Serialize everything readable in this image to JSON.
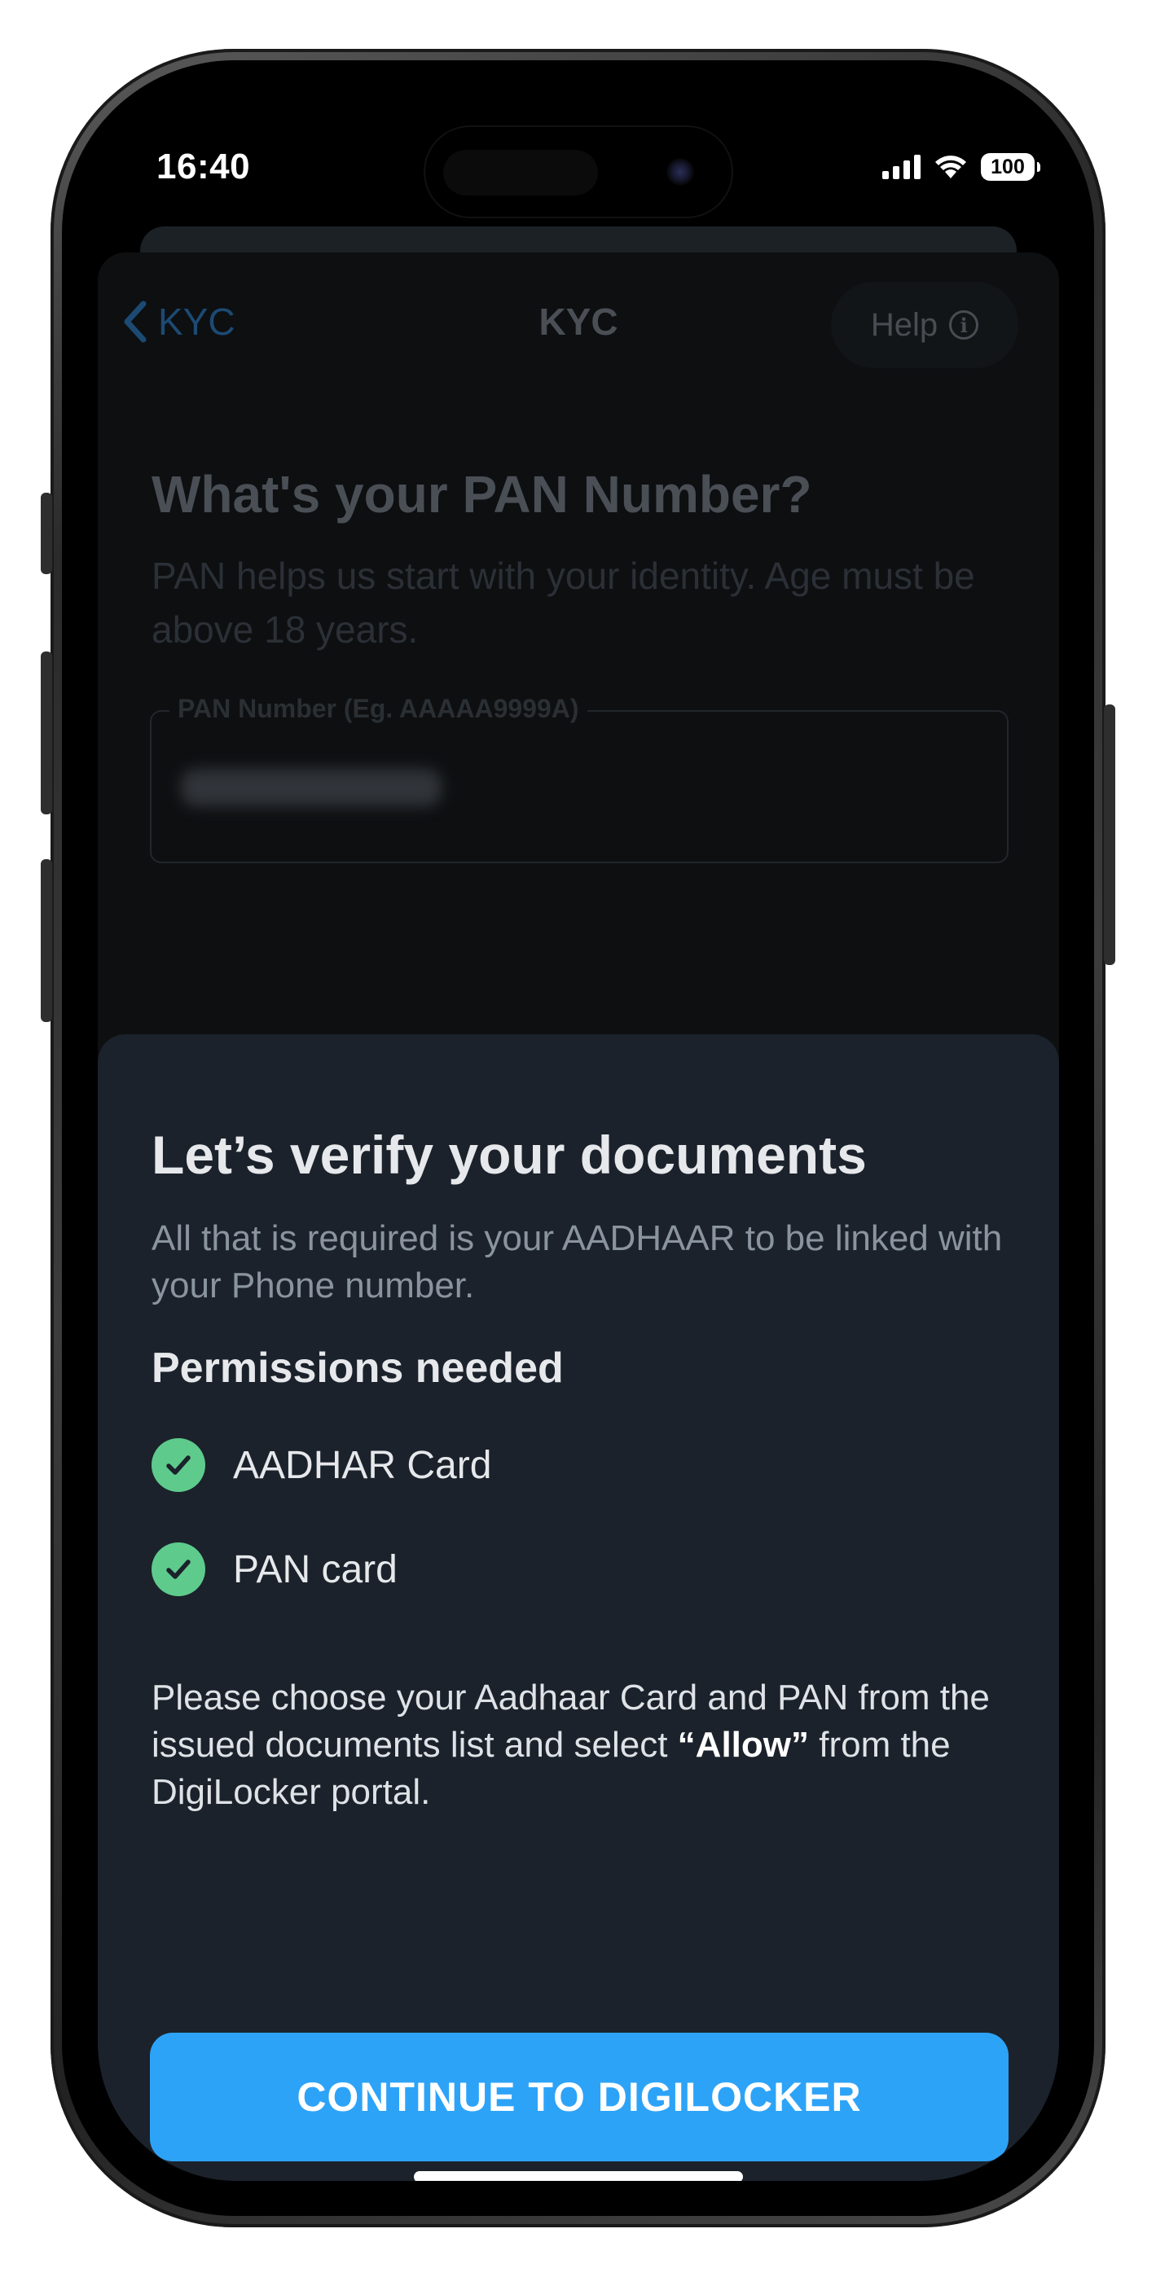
{
  "status_bar": {
    "time": "16:40",
    "battery": "100",
    "icons": [
      "signal-icon",
      "wifi-icon",
      "battery-icon"
    ]
  },
  "kyc": {
    "back_label": "KYC",
    "title": "KYC",
    "help_label": "Help",
    "info_glyph": "i",
    "heading": "What's your PAN Number?",
    "subheading": "PAN helps us start with your identity. Age must be above 18 years.",
    "pan_field": {
      "label": "PAN Number (Eg. AAAAA9999A)"
    }
  },
  "sheet": {
    "title": "Let’s verify your documents",
    "subtitle": "All that is required is your AADHAAR to be linked with your Phone number.",
    "permissions_heading": "Permissions needed",
    "permissions": [
      {
        "label": "AADHAR Card",
        "icon": "check-circle-icon"
      },
      {
        "label": "PAN card",
        "icon": "check-circle-icon"
      }
    ],
    "instructions_before": "Please choose your Aadhaar Card and PAN from the issued documents list and select ",
    "instructions_bold": "“Allow”",
    "instructions_after": " from the DigiLocker portal.",
    "cta_label": "CONTINUE TO DIGILOCKER"
  },
  "colors": {
    "sheet_bg": "#1b222b",
    "cta": "#2da3f8",
    "check": "#5ecb8c",
    "background_screen": "#0d0f11"
  }
}
